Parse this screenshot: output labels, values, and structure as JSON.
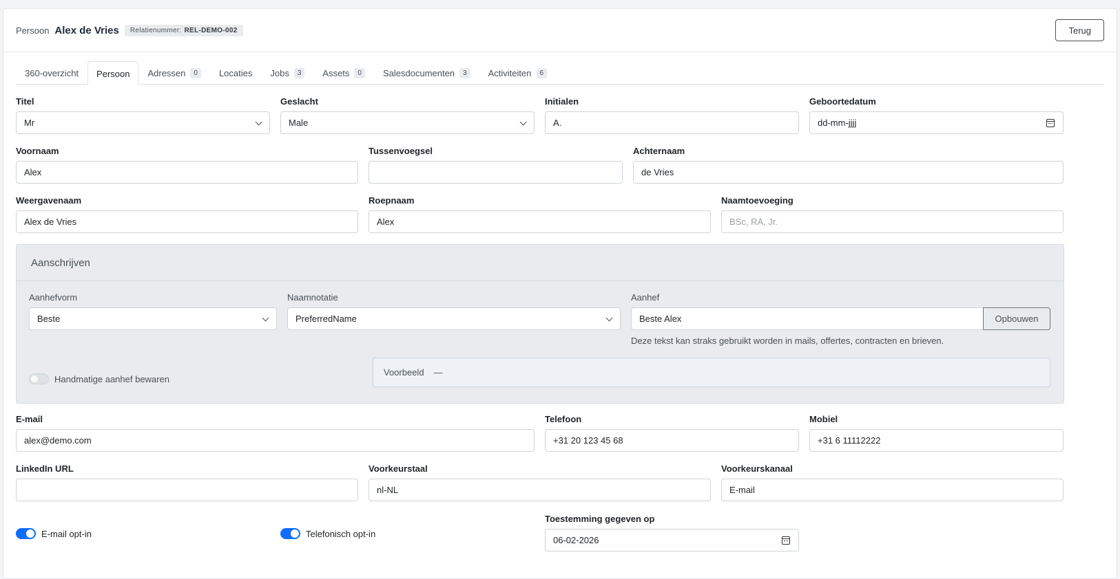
{
  "header": {
    "kind": "Persoon",
    "name": "Alex de Vries",
    "relation_label": "Relatienummer:",
    "relation_value": "REL-DEMO-002",
    "back_label": "Terug"
  },
  "tabs": [
    {
      "label": "360-overzicht",
      "count": ""
    },
    {
      "label": "Persoon",
      "count": "",
      "active": true
    },
    {
      "label": "Adressen",
      "count": "0"
    },
    {
      "label": "Locaties",
      "count": ""
    },
    {
      "label": "Jobs",
      "count": "3"
    },
    {
      "label": "Assets",
      "count": "0"
    },
    {
      "label": "Salesdocumenten",
      "count": "3"
    },
    {
      "label": "Activiteiten",
      "count": "6"
    }
  ],
  "form": {
    "titel": {
      "label": "Titel",
      "value": "Mr"
    },
    "geslacht": {
      "label": "Geslacht",
      "value": "Male"
    },
    "initialen": {
      "label": "Initialen",
      "value": "A."
    },
    "geboortedatum": {
      "label": "Geboortedatum",
      "value": "dd-mm-jjjj"
    },
    "voornaam": {
      "label": "Voornaam",
      "value": "Alex"
    },
    "tussenvoegsel": {
      "label": "Tussenvoegsel",
      "value": ""
    },
    "achternaam": {
      "label": "Achternaam",
      "value": "de Vries"
    },
    "weergavenaam": {
      "label": "Weergavenaam",
      "value": "Alex de Vries"
    },
    "roepnaam": {
      "label": "Roepnaam",
      "value": "Alex"
    },
    "naamtoevoeging": {
      "label": "Naamtoevoeging",
      "value": "",
      "placeholder": "BSc, RA, Jr."
    },
    "email": {
      "label": "E-mail",
      "value": "alex@demo.com"
    },
    "telefoon": {
      "label": "Telefoon",
      "value": "+31 20 123 45 68"
    },
    "mobiel": {
      "label": "Mobiel",
      "value": "+31 6 11112222"
    },
    "linkedin": {
      "label": "LinkedIn URL",
      "value": ""
    },
    "voorkeurstaal": {
      "label": "Voorkeurstaal",
      "value": "nl-NL"
    },
    "voorkeurskanaal": {
      "label": "Voorkeurskanaal",
      "value": "E-mail"
    },
    "toestemming": {
      "label": "Toestemming gegeven op",
      "value": "06-02-2026"
    },
    "email_optin": {
      "label": "E-mail opt-in",
      "on": true
    },
    "tel_optin": {
      "label": "Telefonisch opt-in",
      "on": true
    }
  },
  "aanschrijven": {
    "title": "Aanschrijven",
    "aanhefvorm": {
      "label": "Aanhefvorm",
      "value": "Beste"
    },
    "naamnotatie": {
      "label": "Naamnotatie",
      "value": "PreferredName"
    },
    "aanhef": {
      "label": "Aanhef",
      "value": "Beste Alex"
    },
    "build_label": "Opbouwen",
    "hint": "Deze tekst kan straks gebruikt worden in mails, offertes, contracten en brieven.",
    "manual_label": "Handmatige aanhef bewaren",
    "manual_on": false,
    "preview_label": "Voorbeeld",
    "preview_value": "—"
  }
}
